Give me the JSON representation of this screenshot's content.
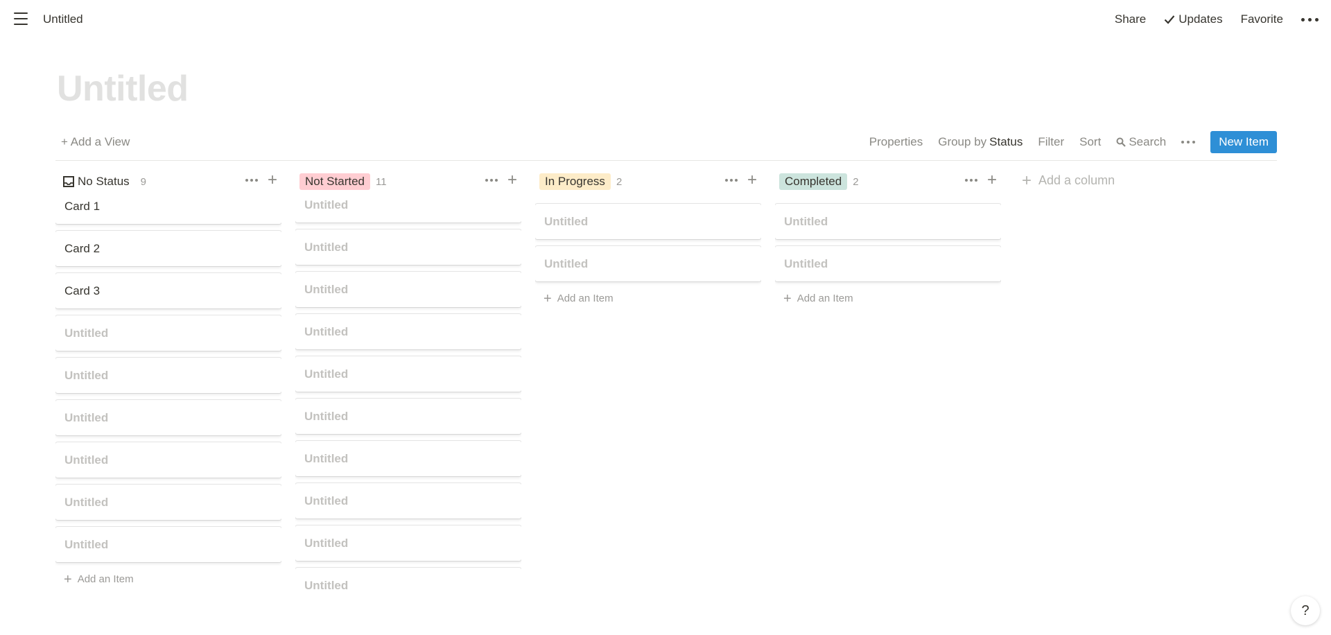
{
  "topbar": {
    "breadcrumb": "Untitled",
    "share": "Share",
    "updates": "Updates",
    "favorite": "Favorite"
  },
  "page": {
    "title": "Untitled"
  },
  "view_bar": {
    "add_view": "+ Add a View",
    "properties": "Properties",
    "group_by_prefix": "Group by",
    "group_by_value": "Status",
    "filter": "Filter",
    "sort": "Sort",
    "search": "Search",
    "new_item": "New Item"
  },
  "columns": [
    {
      "name": "No Status",
      "count": "9",
      "tag_color": "",
      "cards": [
        "Card 1",
        "Card 2",
        "Card 3",
        "Untitled",
        "Untitled",
        "Untitled",
        "Untitled",
        "Untitled",
        "Untitled"
      ],
      "add_item": "Add an Item"
    },
    {
      "name": "Not Started",
      "count": "11",
      "tag_color": "#ffcdd2",
      "cards": [
        "Untitled",
        "Untitled",
        "Untitled",
        "Untitled",
        "Untitled",
        "Untitled",
        "Untitled",
        "Untitled",
        "Untitled",
        "Untitled"
      ],
      "add_item": ""
    },
    {
      "name": "In Progress",
      "count": "2",
      "tag_color": "#fdecc8",
      "cards": [
        "Untitled",
        "Untitled"
      ],
      "add_item": "Add an Item"
    },
    {
      "name": "Completed",
      "count": "2",
      "tag_color": "#cce4dd",
      "cards": [
        "Untitled",
        "Untitled"
      ],
      "add_item": "Add an Item"
    }
  ],
  "add_column": "Add a column",
  "help": "?",
  "colors": {
    "accent": "#2e8fd6",
    "text": "#37352f",
    "muted": "#9b9a97"
  }
}
